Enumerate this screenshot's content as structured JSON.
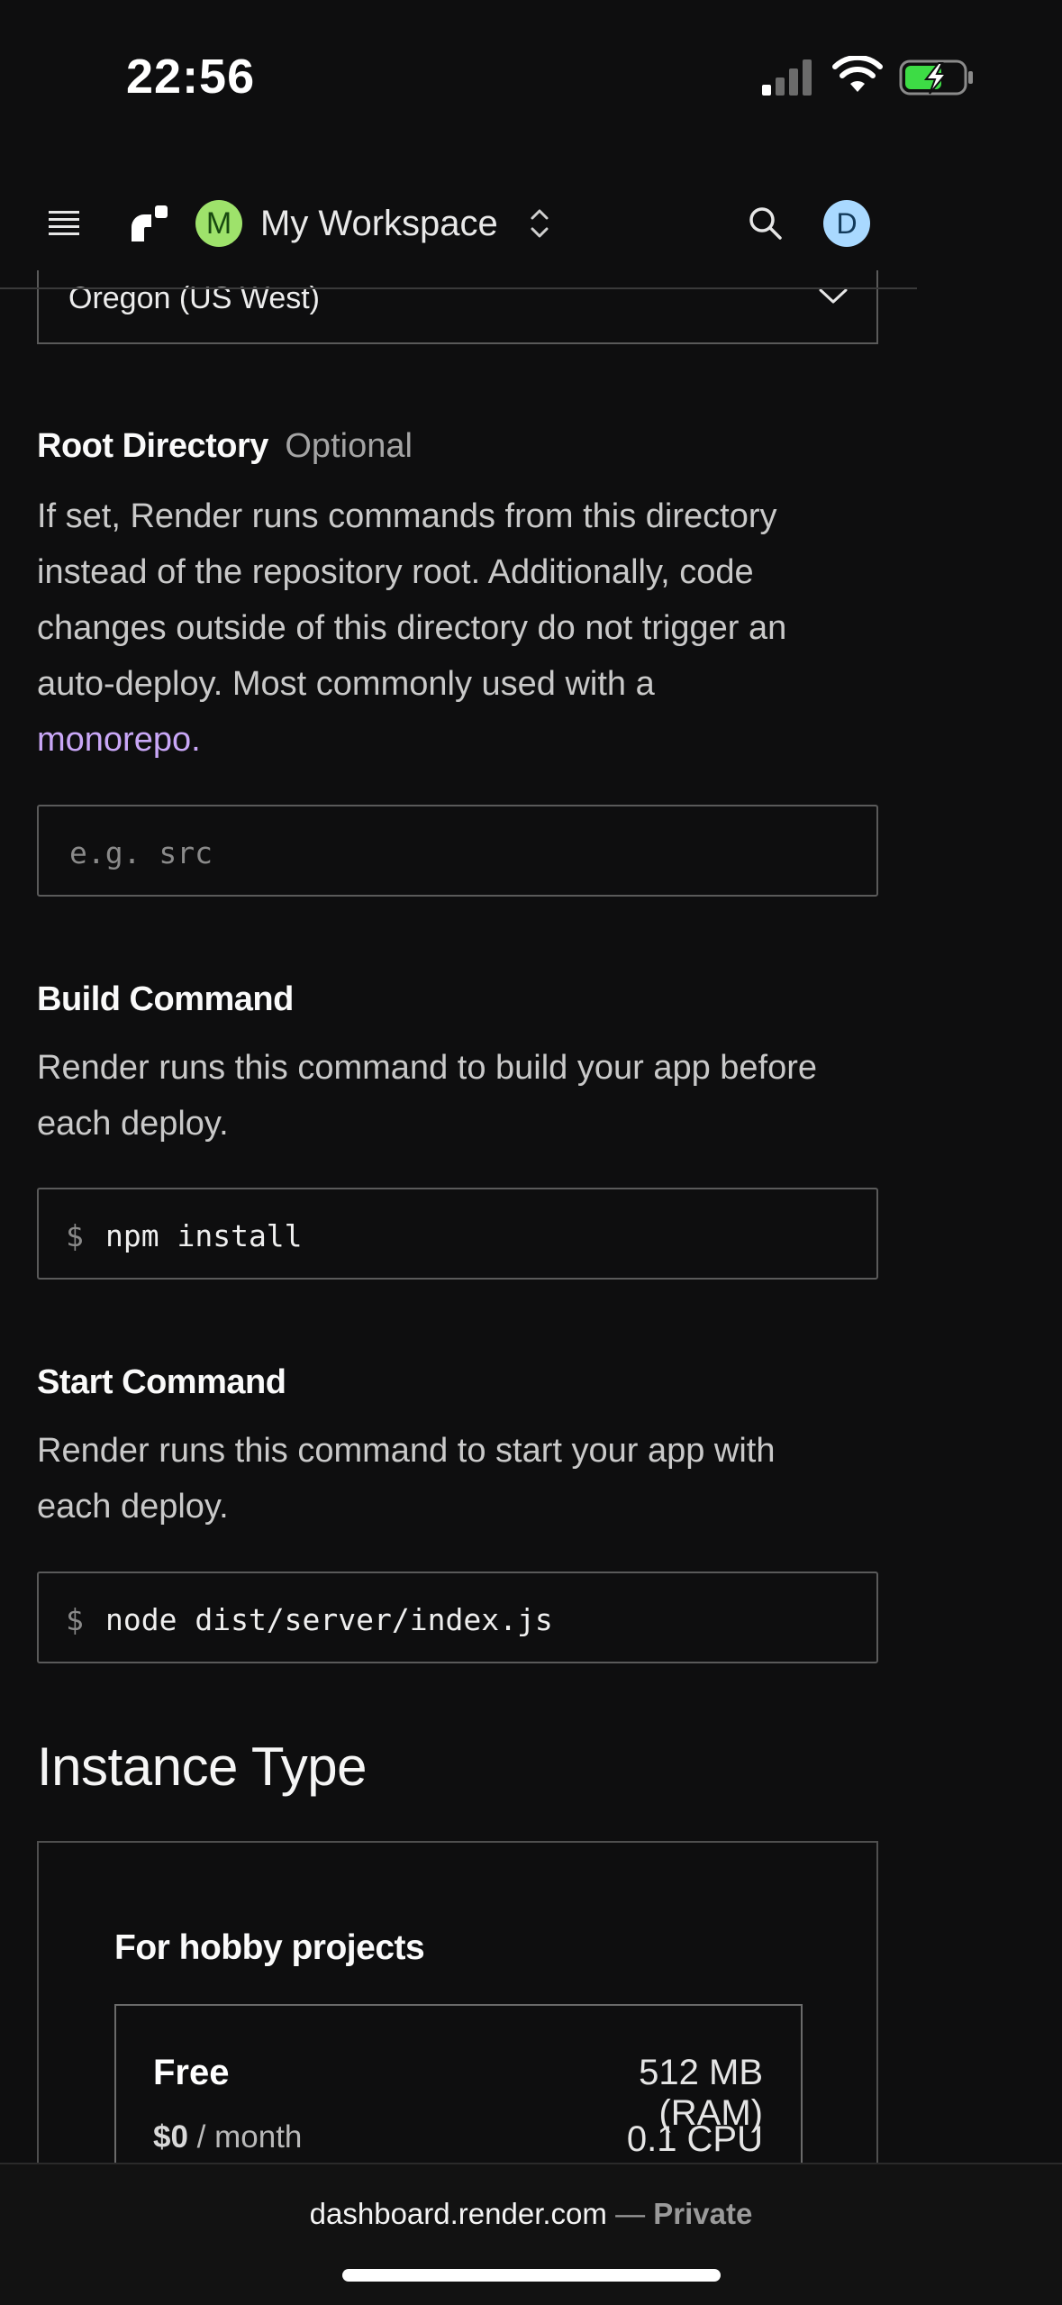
{
  "status_bar": {
    "time": "22:56"
  },
  "nav": {
    "workspace_initial": "M",
    "workspace_name": "My Workspace",
    "user_initial": "D"
  },
  "region": {
    "selected": "Oregon (US West)"
  },
  "root_directory": {
    "label": "Root Directory",
    "optional": "Optional",
    "desc_lines": [
      "If set, Render runs commands from this directory",
      "instead of the repository root. Additionally, code",
      "changes outside of this directory do not trigger an",
      "auto-deploy. Most commonly used with a"
    ],
    "link": "monorepo.",
    "placeholder": "e.g. src"
  },
  "build_command": {
    "label": "Build Command",
    "desc_lines": [
      "Render runs this command to build your app before",
      "each deploy."
    ],
    "prefix": "$",
    "value": "npm install"
  },
  "start_command": {
    "label": "Start Command",
    "desc_lines": [
      "Render runs this command to start your app with",
      "each deploy."
    ],
    "prefix": "$",
    "value": "node dist/server/index.js"
  },
  "instance_type": {
    "heading": "Instance Type",
    "group_label": "For hobby projects",
    "plan": {
      "name": "Free",
      "ram": "512 MB (RAM)",
      "price": "$0",
      "period": "/ month",
      "cpu": "0.1 CPU"
    }
  },
  "browser": {
    "domain": "dashboard.render.com",
    "separator": "—",
    "privacy": "Private"
  },
  "colors": {
    "background": "#0e0e0f",
    "link": "#c9a7f7",
    "workspace_avatar": "#9ee26b",
    "user_avatar": "#a9d9ff",
    "battery_charging": "#3ddc45"
  }
}
